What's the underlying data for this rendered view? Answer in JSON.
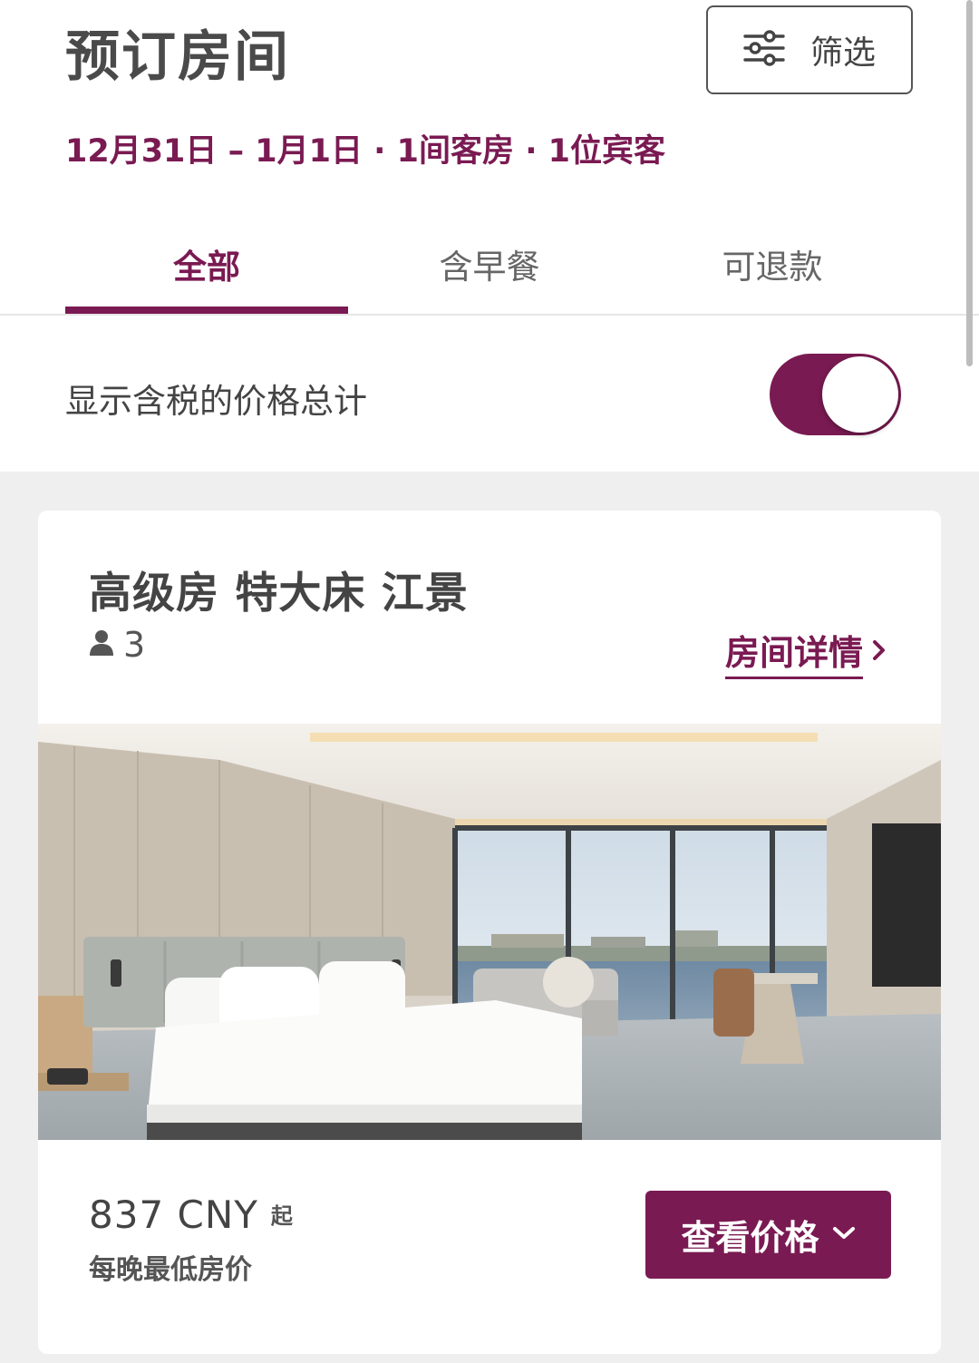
{
  "header": {
    "title": "预订房间",
    "filter_label": "筛选",
    "filter_icon": "sliders-icon",
    "booking_summary": "12月31日 – 1月1日 · 1间客房 · 1位宾客"
  },
  "tabs": [
    {
      "label": "全部",
      "active": true
    },
    {
      "label": "含早餐",
      "active": false
    },
    {
      "label": "可退款",
      "active": false
    }
  ],
  "tax_toggle": {
    "label": "显示含税的价格总计",
    "on": true
  },
  "room": {
    "name": "高级房 特大床 江景",
    "guest_icon": "person-icon",
    "guests": "3",
    "details_link": "房间详情",
    "details_icon": "chevron-right-icon",
    "price": "837 CNY",
    "price_suffix": "起",
    "price_note": "每晚最低房价",
    "view_price_label": "查看价格",
    "view_price_icon": "chevron-down-icon"
  },
  "colors": {
    "brand": "#7a1a52",
    "text": "#444444",
    "background": "#efefef"
  }
}
